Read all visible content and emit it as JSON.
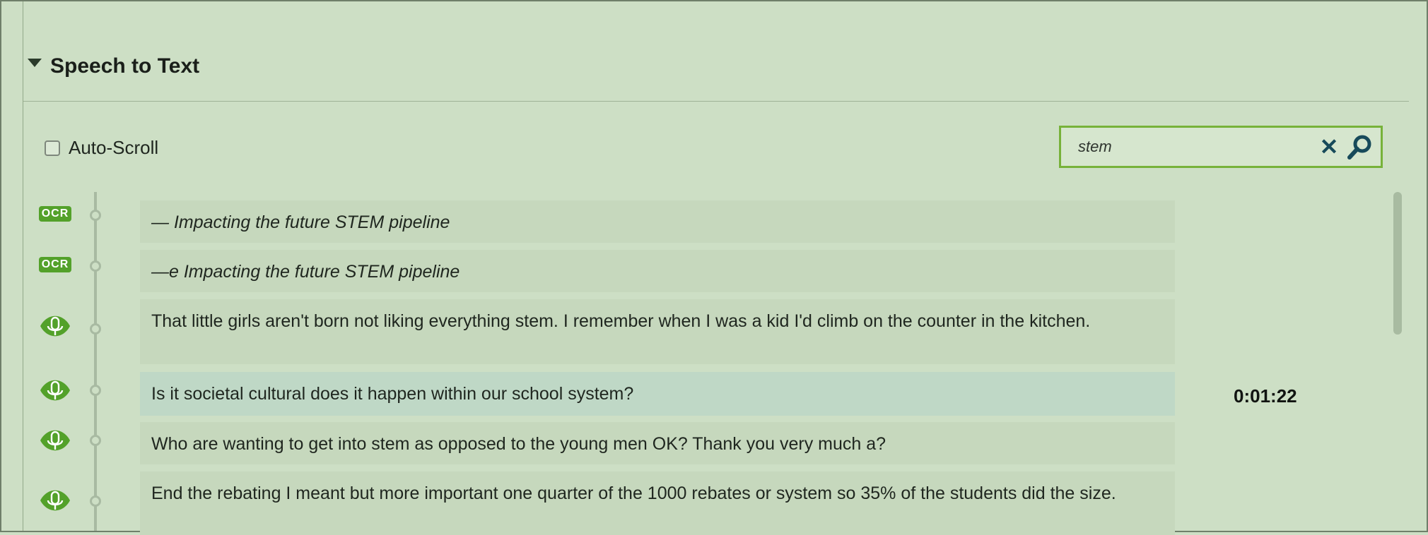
{
  "panel": {
    "title": "Speech to Text"
  },
  "controls": {
    "auto_scroll_label": "Auto-Scroll",
    "auto_scroll_checked": false,
    "search_value": "stem",
    "clear_symbol": "✕"
  },
  "badges": {
    "ocr_label": "OCR",
    "speech_icon": "microphone-icon"
  },
  "transcript": [
    {
      "type": "ocr",
      "text": "— Impacting the future STEM pipeline"
    },
    {
      "type": "ocr",
      "text": "—e Impacting the future STEM pipeline"
    },
    {
      "type": "speech",
      "text": "That little girls aren't born not liking everything stem. I remember when I was a kid I'd climb on the counter in the kitchen."
    },
    {
      "type": "speech",
      "text": "Is it societal cultural does it happen within our school system?",
      "active": true
    },
    {
      "type": "speech",
      "text": "Who are wanting to get into stem as opposed to the young men OK? Thank you very much a?"
    },
    {
      "type": "speech",
      "text": "End the rebating I meant but more important one quarter of the 1000 rebates or system so 35% of the students did the size."
    }
  ],
  "current_timestamp": "0:01:22",
  "colors": {
    "background": "#cddfc5",
    "accent_green": "#53a12a",
    "search_border": "#77b23a",
    "icon_teal": "#174a5a"
  }
}
